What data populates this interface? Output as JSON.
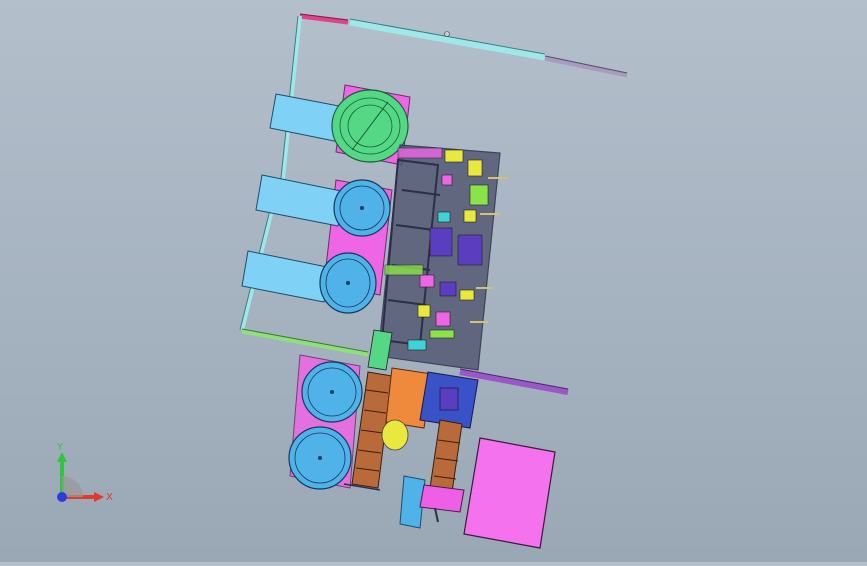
{
  "scene": {
    "background_top": "#b3bfcb",
    "background_bottom": "#9aa8b6",
    "colors": {
      "frame_cyan": "#9fe8ea",
      "frame_pink": "#e0428c",
      "frame_lilac": "#a79bbe",
      "frame_green": "#8fe07a",
      "frame_purple": "#9a58c6",
      "panel_blue": "#7fd2f6",
      "turntable_green": "#55d885",
      "turntable_blue": "#4fb2e8",
      "magenta": "#ee66e6",
      "orange": "#ef8a3c",
      "brown": "#b86a3a",
      "yellow": "#e9e83e",
      "indigo": "#5a3ec0",
      "dark_frame": "#2b2f48"
    }
  },
  "triad": {
    "x_label": "X",
    "y_label": "Y",
    "x_color": "#e23a2a",
    "y_color": "#2fc63c",
    "z_color": "#2a3ee0"
  }
}
